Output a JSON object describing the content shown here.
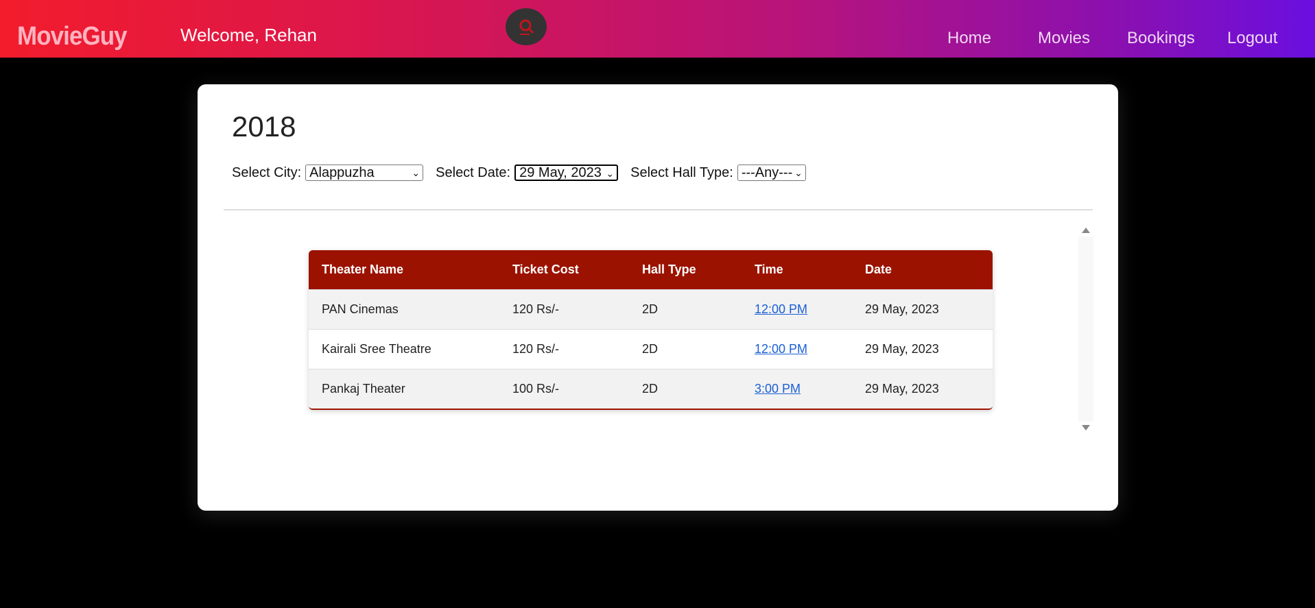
{
  "header": {
    "brand": "MovieGuy",
    "welcome": "Welcome, Rehan",
    "nav": [
      "Home",
      "Movies",
      "Bookings",
      "Logout"
    ],
    "icons": {
      "search": "search-icon"
    }
  },
  "movie": {
    "title": "2018"
  },
  "filters": {
    "city_label": "Select City:",
    "city_value": "Alappuzha",
    "date_label": "Select Date:",
    "date_value": "29 May, 2023",
    "hall_label": "Select Hall Type:",
    "hall_value": "---Any---"
  },
  "table": {
    "headers": [
      "Theater Name",
      "Ticket Cost",
      "Hall Type",
      "Time",
      "Date"
    ],
    "rows": [
      {
        "theater": "PAN Cinemas",
        "cost": "120 Rs/-",
        "hall": "2D",
        "time": "12:00 PM",
        "date": "29 May, 2023"
      },
      {
        "theater": "Kairali Sree Theatre",
        "cost": "120 Rs/-",
        "hall": "2D",
        "time": "12:00 PM",
        "date": "29 May, 2023"
      },
      {
        "theater": "Pankaj Theater",
        "cost": "100 Rs/-",
        "hall": "2D",
        "time": "3:00 PM",
        "date": "29 May, 2023"
      }
    ]
  },
  "colors": {
    "header_gradient_start": "#f21c2c",
    "header_gradient_end": "#6a0fe0",
    "table_header": "#9b1300",
    "link": "#1a5fd6"
  }
}
